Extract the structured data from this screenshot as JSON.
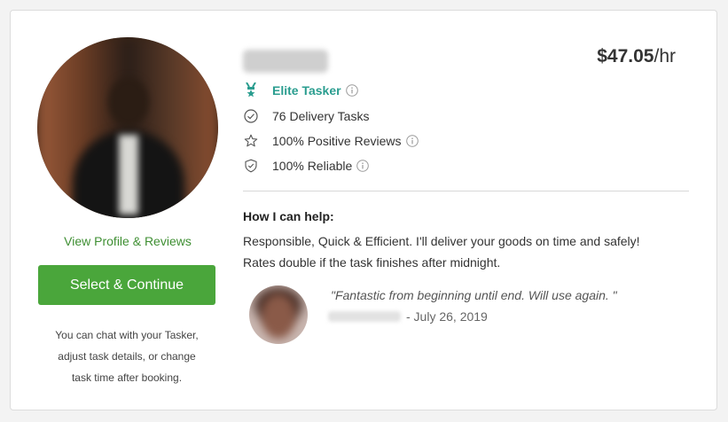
{
  "tasker": {
    "rate": "$47.05",
    "rate_unit": "/hr",
    "stats": {
      "elite": "Elite Tasker",
      "tasks": "76 Delivery Tasks",
      "reviews": "100% Positive Reviews",
      "reliable": "100% Reliable"
    },
    "help_title": "How I can help:",
    "help_lines": [
      "Responsible, Quick & Efficient. I'll deliver your goods on time and safely!",
      "Rates double if the task finishes after midnight."
    ],
    "review": {
      "quote": "\"Fantastic from beginning until end. Will use again. \"",
      "date": "- July 26, 2019"
    }
  },
  "actions": {
    "view_profile": "View Profile & Reviews",
    "select": "Select & Continue",
    "chat_note": [
      "You can chat with your Tasker,",
      "adjust task details, or change",
      "task time after booking."
    ]
  },
  "colors": {
    "accent_green": "#4aa63b",
    "link_green": "#3f8f33",
    "elite_teal": "#2a9d8f"
  },
  "icons": {
    "elite": "award-ribbon-icon",
    "tasks": "check-circle-icon",
    "reviews": "star-outline-icon",
    "reliable": "shield-check-icon",
    "info": "info-circle-icon"
  }
}
